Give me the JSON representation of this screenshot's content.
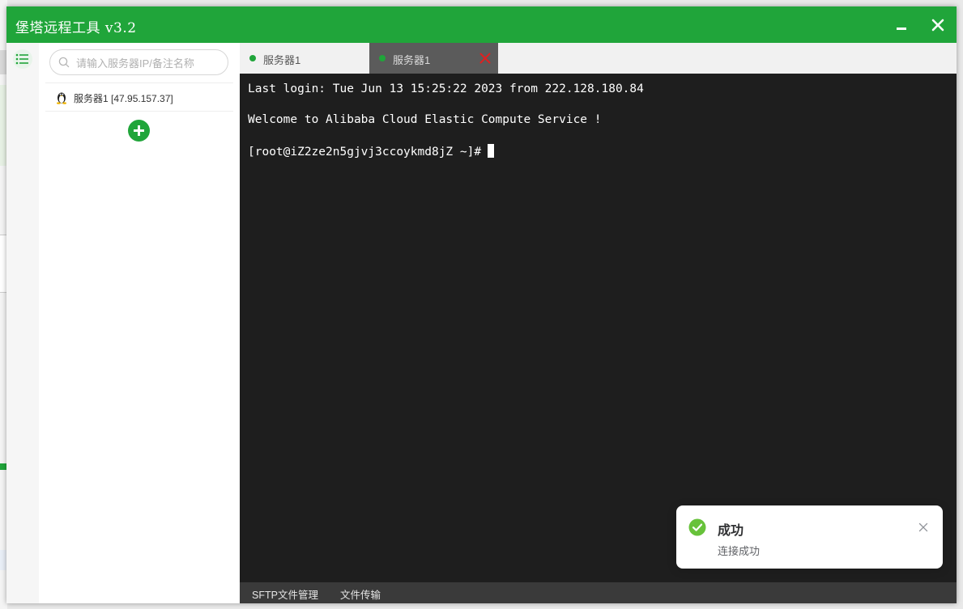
{
  "app": {
    "title": "堡塔远程工具 v3.2"
  },
  "sidebar": {
    "search_placeholder": "请输入服务器IP/备注名称",
    "servers": [
      {
        "label": "服务器1 [47.95.157.37]",
        "os_icon": "linux-penguin-icon"
      }
    ]
  },
  "tabs": [
    {
      "label": "服务器1",
      "status_color": "#20a53a",
      "active": false
    },
    {
      "label": "服务器1",
      "status_color": "#20a53a",
      "active": true
    }
  ],
  "terminal": {
    "lines": [
      "Last login: Tue Jun 13 15:25:22 2023 from 222.128.180.84",
      "Welcome to Alibaba Cloud Elastic Compute Service !",
      "[root@iZ2ze2n5gjvj3ccoykmd8jZ ~]#"
    ]
  },
  "footer": {
    "sftp_label": "SFTP文件管理",
    "transfer_label": "文件传输"
  },
  "toast": {
    "title": "成功",
    "message": "连接成功"
  },
  "colors": {
    "brand": "#20a53a",
    "terminal_bg": "#1e1e1e",
    "tab_close": "#e02020"
  }
}
